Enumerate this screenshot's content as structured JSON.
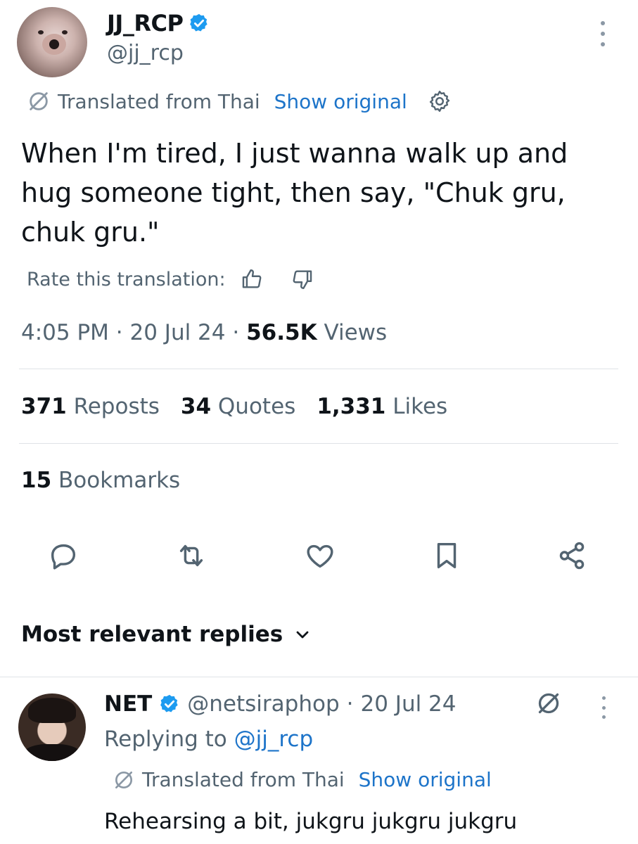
{
  "tweet": {
    "author": {
      "name": "JJ_RCP",
      "handle": "@jj_rcp",
      "verified": true
    },
    "translation": {
      "note": "Translated from Thai",
      "show_original": "Show original"
    },
    "text": "When I'm tired, I just wanna walk up and hug someone tight, then say, \"Chuk gru, chuk gru.\"",
    "rate_label": "Rate this translation:",
    "time": "4:05 PM",
    "date": "20 Jul 24",
    "views_count": "56.5K",
    "views_label": "Views",
    "sep": "·",
    "stats": {
      "reposts_count": "371",
      "reposts_label": "Reposts",
      "quotes_count": "34",
      "quotes_label": "Quotes",
      "likes_count": "1,331",
      "likes_label": "Likes",
      "bookmarks_count": "15",
      "bookmarks_label": "Bookmarks"
    },
    "actions": [
      "reply-icon",
      "repost-icon",
      "like-icon",
      "bookmark-icon",
      "share-icon"
    ]
  },
  "replies_header": "Most relevant replies",
  "reply": {
    "name": "NET",
    "handle": "@netsiraphop",
    "date": "20 Jul 24",
    "replying_to_label": "Replying to",
    "replying_to_handle": "@jj_rcp",
    "translation_note": "Translated from Thai",
    "show_original": "Show original",
    "text": "Rehearsing a bit, jukgru jukgru jukgru"
  },
  "colors": {
    "accent": "#1d9bf0",
    "link": "#1d74c9",
    "muted": "#536471",
    "text": "#0f1419",
    "divider": "#dfe3e7"
  }
}
